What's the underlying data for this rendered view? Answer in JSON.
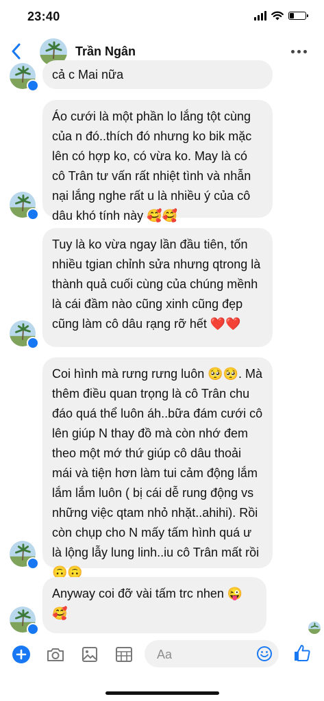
{
  "status_bar": {
    "time": "23:40"
  },
  "header": {
    "contact_name": "Trần Ngân"
  },
  "messages": [
    {
      "text": "cả c Mai nữa"
    },
    {
      "text": "Áo cưới là một phần lo lắng tột cùng của n đó..thích đó nhưng ko bik mặc lên có hợp ko, có vừa ko. May là có cô Trân tư vấn rất nhiệt tình và nhẫn nại lắng nghe rất u là nhiều ý của cô dâu khó tính này 🥰🥰"
    },
    {
      "text": "Tuy là ko vừa ngay lần đầu tiên, tốn nhiều tgian chỉnh sửa nhưng qtrong là thành quả cuối cùng của chúng mềnh là cái đầm nào cũng xinh cũng đẹp cũng làm cô dâu rạng rỡ hết ❤️❤️"
    },
    {
      "text": "Coi hình mà rưng rưng luôn 🥺🥺. Mà thêm điều quan trọng là cô Trân chu đáo quá thể luôn áh..bữa đám cưới cô lên giúp N thay đồ mà còn nhớ đem theo một mớ thứ giúp cô dâu thoải mái và tiện hơn làm tui cảm động lắm lắm lắm luôn ( bị cái dễ rung động vs những việc qtam nhỏ nhặt..ahihi). Rồi còn chụp cho N mấy tấm hình quá ư là lộng lẫy lung linh..iu cô Trân mất rồi 🙃🙃"
    },
    {
      "text": "Anyway coi đỡ vài tấm trc nhen 😜 🥰"
    }
  ],
  "composer": {
    "placeholder": "Aa"
  },
  "colors": {
    "accent": "#1877f2",
    "bubble": "#f1f0f0"
  }
}
